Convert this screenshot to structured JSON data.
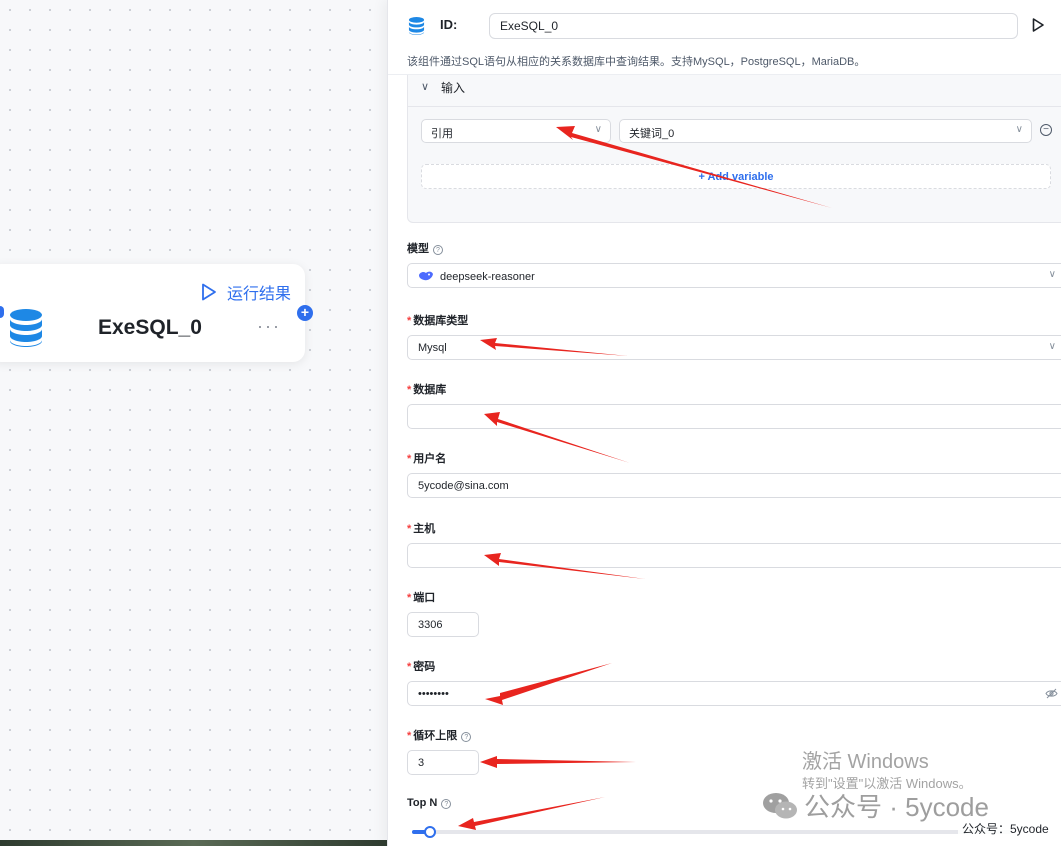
{
  "node": {
    "run_label": "运行结果",
    "title": "ExeSQL_0",
    "more": "···"
  },
  "panel": {
    "id_label": "ID:",
    "id_value": "ExeSQL_0",
    "description": "该组件通过SQL语句从相应的关系数据库中查询结果。支持MySQL，PostgreSQL，MariaDB。",
    "input_section": {
      "title": "输入",
      "rows": [
        {
          "type": "引用",
          "value": "关键词_0"
        }
      ],
      "add_variable": "Add variable"
    },
    "model": {
      "label": "模型",
      "value": "deepseek-reasoner"
    },
    "db_type": {
      "label": "数据库类型",
      "value": "Mysql",
      "required": "*"
    },
    "database": {
      "label": "数据库",
      "value": "",
      "required": "*"
    },
    "username": {
      "label": "用户名",
      "value": "5ycode@sina.com",
      "required": "*"
    },
    "host": {
      "label": "主机",
      "value": "",
      "required": "*"
    },
    "port": {
      "label": "端口",
      "value": "3306",
      "required": "*"
    },
    "password": {
      "label": "密码",
      "value": "••••••••",
      "required": "*"
    },
    "loop_limit": {
      "label": "循环上限",
      "value": "3",
      "required": "*"
    },
    "top_n": {
      "label": "Top N",
      "value": 0.03
    }
  },
  "watermark": {
    "title": "激活 Windows",
    "subtitle": "转到\"设置\"以激活 Windows。",
    "brand": "公众号 · 5ycode",
    "small": "公众号：5ycode"
  },
  "colors": {
    "accent": "#2f6fed",
    "required": "#f53f3f",
    "arrow": "#e8251f"
  }
}
